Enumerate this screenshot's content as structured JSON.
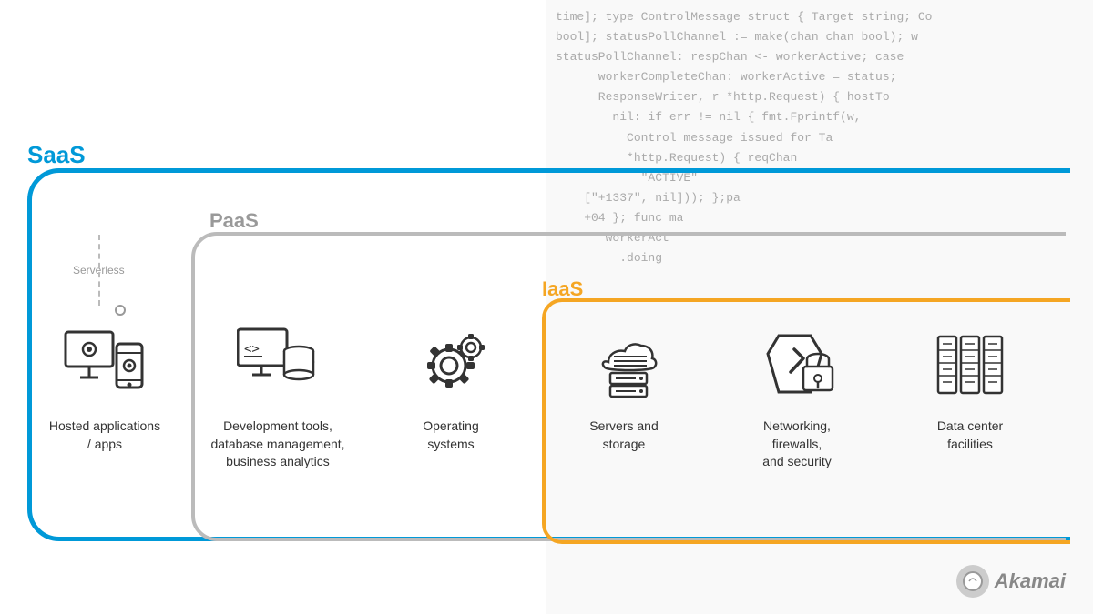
{
  "code_lines": [
    "time]; type ControlMessage struct { Target string; Co",
    "bool]; statusPollChannel := make(chan chan bool); w",
    "statusPollChannel: respChan <- workerActive; case",
    "      workerCompleteChan: workerActive = status;",
    "      ResponseWriter, r *http.Request) { hostTo",
    "        nil: if err != nil { fmt.Fprintf(w,",
    "          Control message issued for Ta",
    "          *http.Request) { reqChan",
    "            \"ACTIVE\"",
    "    [\"+1337\", nil])); };pa",
    "    +04 }; func ma",
    "       workerAct",
    "         .doing"
  ],
  "labels": {
    "saas": "SaaS",
    "paas": "PaaS",
    "iaas": "IaaS",
    "serverless": "Serverless"
  },
  "items": [
    {
      "id": "hosted-apps",
      "label": "Hosted applications\n/ apps",
      "label_lines": [
        "Hosted applications",
        "/ apps"
      ]
    },
    {
      "id": "dev-tools",
      "label": "Development tools, database management, business analytics",
      "label_lines": [
        "Development tools,",
        "database",
        "management,",
        "business analytics"
      ]
    },
    {
      "id": "operating-systems",
      "label": "Operating systems",
      "label_lines": [
        "Operating",
        "systems"
      ]
    },
    {
      "id": "servers-storage",
      "label": "Servers and storage",
      "label_lines": [
        "Servers and",
        "storage"
      ]
    },
    {
      "id": "networking",
      "label": "Networking, firewalls, and security",
      "label_lines": [
        "Networking,",
        "firewalls,",
        "and security"
      ]
    },
    {
      "id": "data-center",
      "label": "Data center facilities",
      "label_lines": [
        "Data center",
        "facilities"
      ]
    }
  ],
  "akamai": {
    "text": "Akamai"
  },
  "colors": {
    "saas": "#0099d8",
    "paas": "#aaaaaa",
    "iaas": "#f5a623",
    "text": "#333333",
    "code": "#bbbbbb"
  }
}
